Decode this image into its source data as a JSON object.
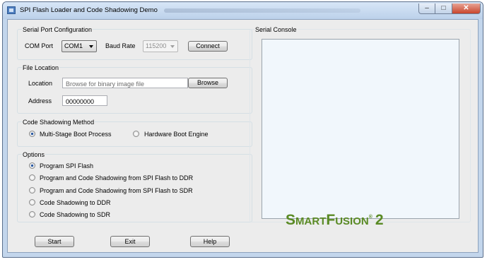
{
  "window": {
    "title": "SPI Flash Loader and Code Shadowing Demo",
    "controls": {
      "minimize": "–",
      "maximize": "□",
      "close": "✕"
    }
  },
  "serial_port": {
    "group_title": "Serial Port Configuration",
    "com_port_label": "COM Port",
    "com_port_value": "COM1",
    "baud_rate_label": "Baud Rate",
    "baud_rate_value": "115200",
    "connect_label": "Connect"
  },
  "file_location": {
    "group_title": "File Location",
    "location_label": "Location",
    "location_placeholder": "Browse for binary image file",
    "browse_label": "Browse",
    "address_label": "Address",
    "address_value": "00000000"
  },
  "shadowing_method": {
    "group_title": "Code Shadowing Method",
    "options": [
      {
        "label": "Multi-Stage Boot Process",
        "checked": true
      },
      {
        "label": "Hardware Boot Engine",
        "checked": false
      }
    ]
  },
  "options": {
    "group_title": "Options",
    "items": [
      {
        "label": "Program SPI Flash",
        "checked": true
      },
      {
        "label": "Program and Code Shadowing from SPI Flash to DDR",
        "checked": false
      },
      {
        "label": "Program and Code Shadowing from SPI Flash to SDR",
        "checked": false
      },
      {
        "label": "Code Shadowing to DDR",
        "checked": false
      },
      {
        "label": "Code Shadowing to SDR",
        "checked": false
      }
    ]
  },
  "serial_console": {
    "group_title": "Serial Console"
  },
  "actions": {
    "start": "Start",
    "exit": "Exit",
    "help": "Help"
  },
  "logo": {
    "part1": "S",
    "part2": "M",
    "part3": "A",
    "part4": "RT",
    "part5": "F",
    "part6": "USION",
    "reg": "®",
    "version": "2"
  },
  "colors": {
    "brand_green": "#5a8a24",
    "window_frame": "#c3d6ec",
    "close_button": "#c8452c"
  }
}
